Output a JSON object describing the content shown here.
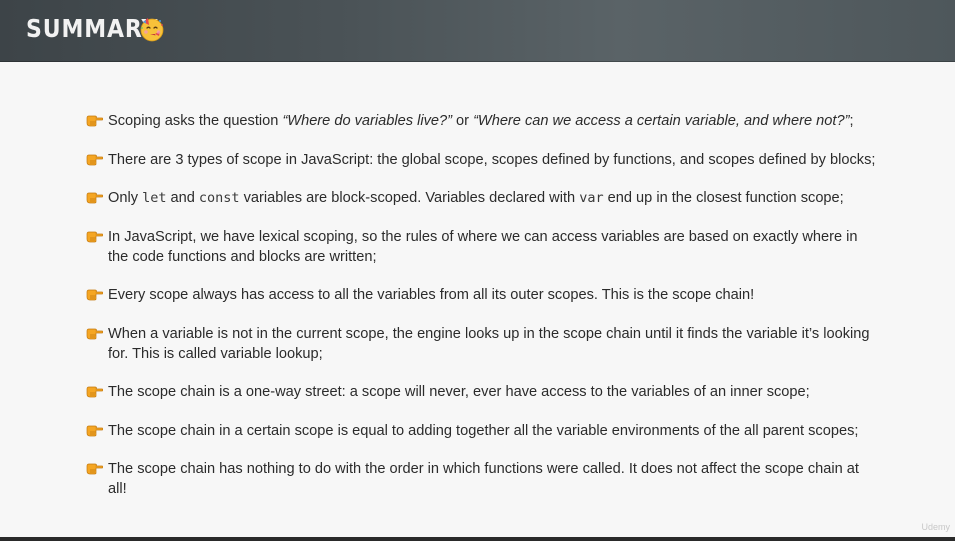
{
  "header": {
    "title": "SUMMARY",
    "emoji_icon": "partying-face-emoji"
  },
  "bullets": [
    {
      "parts": [
        {
          "t": "Scoping asks the question "
        },
        {
          "t": "“Where do variables live?”",
          "style": "em"
        },
        {
          "t": " or "
        },
        {
          "t": "“Where can we access a certain variable, and where not?”",
          "style": "em"
        },
        {
          "t": ";"
        }
      ]
    },
    {
      "parts": [
        {
          "t": "There are 3 types of scope in JavaScript: the global scope, scopes defined by functions, and scopes defined by blocks;"
        }
      ]
    },
    {
      "parts": [
        {
          "t": "Only "
        },
        {
          "t": "let",
          "style": "code"
        },
        {
          "t": " and "
        },
        {
          "t": "const",
          "style": "code"
        },
        {
          "t": " variables are block-scoped. Variables declared with "
        },
        {
          "t": "var",
          "style": "code"
        },
        {
          "t": " end up in the closest function scope;"
        }
      ]
    },
    {
      "parts": [
        {
          "t": "In JavaScript, we have lexical scoping, so the rules of where we can access variables are based on exactly where in the code functions and blocks are written;"
        }
      ]
    },
    {
      "parts": [
        {
          "t": "Every scope always has access to all the variables from all its outer scopes. This is the scope chain!"
        }
      ]
    },
    {
      "parts": [
        {
          "t": "When a variable is not in the current scope, the engine looks up in the scope chain until it finds the variable it’s looking for. This is called variable lookup;"
        }
      ]
    },
    {
      "parts": [
        {
          "t": "The scope chain is a one-way street: a scope will never, ever have access to the variables of an inner scope;"
        }
      ]
    },
    {
      "parts": [
        {
          "t": "The scope chain in a certain scope is equal to adding together all the variable environments of the all parent scopes;"
        }
      ]
    },
    {
      "parts": [
        {
          "t": "The scope chain has nothing to do with the order in which functions were called. It does not affect the scope chain at all!"
        }
      ]
    }
  ],
  "bullet_icon": "pointing-hand-icon",
  "watermark": "Udemy",
  "colors": {
    "header_bg": "#4a5256",
    "text": "#2b2b2b",
    "bullet": "#f5a623"
  }
}
